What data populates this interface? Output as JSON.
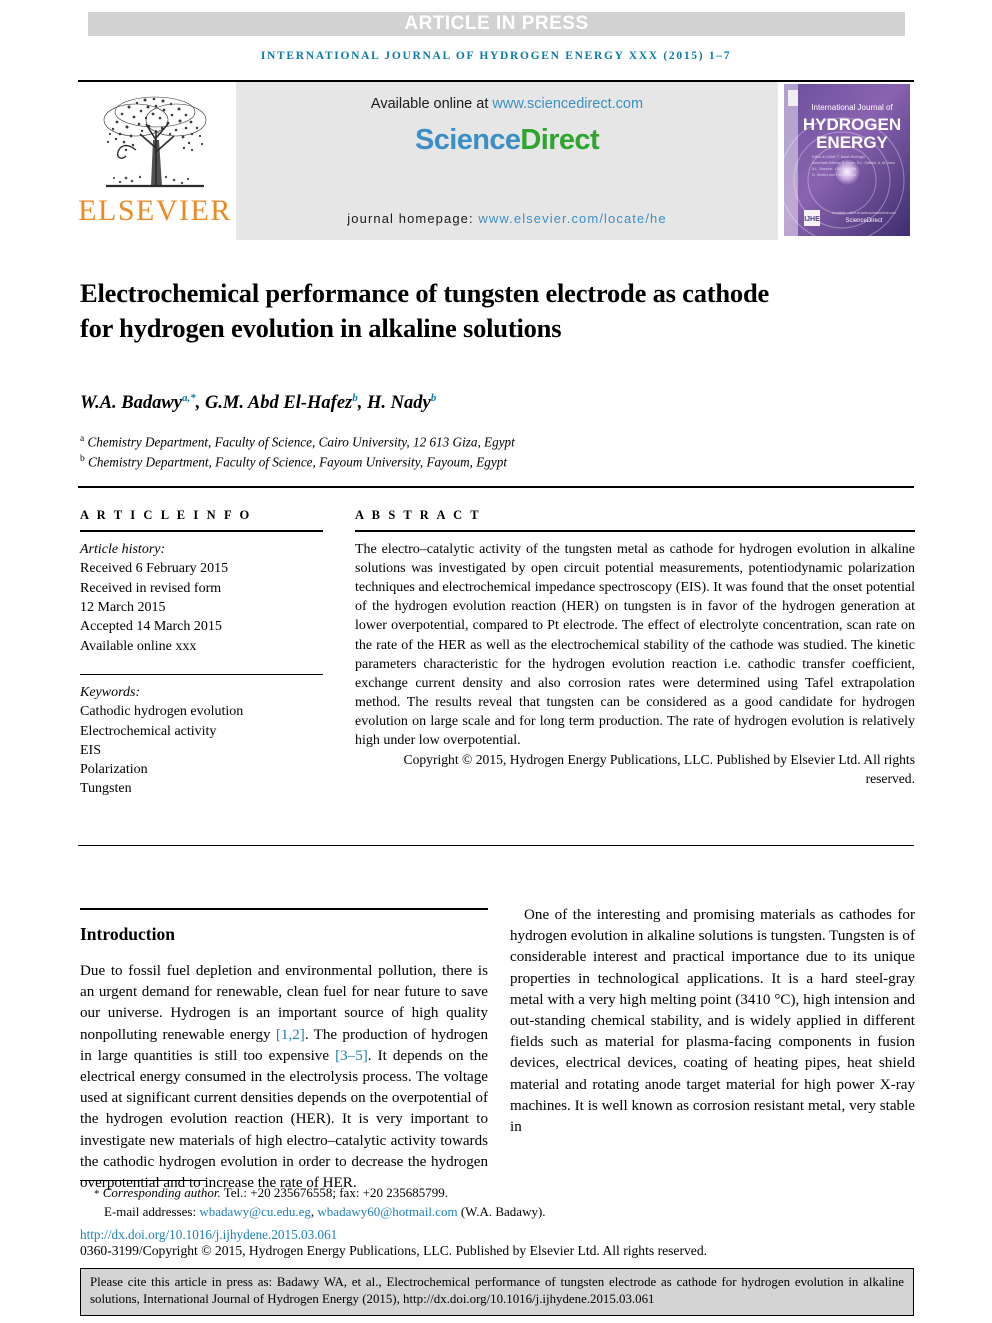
{
  "banner": {
    "text": "ARTICLE IN PRESS"
  },
  "running_head": "INTERNATIONAL JOURNAL OF HYDROGEN ENERGY XXX (2015) 1–7",
  "masthead": {
    "publisher_name": "ELSEVIER",
    "available_prefix": "Available online at ",
    "available_url": "www.sciencedirect.com",
    "logo_part1": "Science",
    "logo_part2": "Direct",
    "homepage_prefix": "journal homepage: ",
    "homepage_url": "www.elsevier.com/locate/he",
    "cover": {
      "line1": "International Journal of",
      "line2": "HYDROGEN",
      "line3": "ENERGY",
      "badge": "IJHE",
      "footer": "ScienceDirect"
    }
  },
  "article": {
    "title": "Electrochemical performance of tungsten electrode as cathode for hydrogen evolution in alkaline solutions",
    "authors": [
      {
        "name": "W.A. Badawy",
        "marks": "a,*"
      },
      {
        "name": "G.M. Abd El-Hafez",
        "marks": "b"
      },
      {
        "name": "H. Nady",
        "marks": "b"
      }
    ],
    "affiliations": [
      {
        "mark": "a",
        "text": "Chemistry Department, Faculty of Science, Cairo University, 12 613 Giza, Egypt"
      },
      {
        "mark": "b",
        "text": "Chemistry Department, Faculty of Science, Fayoum University, Fayoum, Egypt"
      }
    ]
  },
  "article_info": {
    "heading": "A R T I C L E    I N F O",
    "history_label": "Article history:",
    "history": [
      "Received 6 February 2015",
      "Received in revised form",
      "12 March 2015",
      "Accepted 14 March 2015",
      "Available online xxx"
    ],
    "keywords_label": "Keywords:",
    "keywords": [
      "Cathodic hydrogen evolution",
      "Electrochemical activity",
      "EIS",
      "Polarization",
      "Tungsten"
    ]
  },
  "abstract": {
    "heading": "A B S T R A C T",
    "text": "The electro–catalytic activity of the tungsten metal as cathode for hydrogen evolution in alkaline solutions was investigated by open circuit potential measurements, potentiodynamic polarization techniques and electrochemical impedance spectroscopy (EIS). It was found that the onset potential of the hydrogen evolution reaction (HER) on tungsten is in favor of the hydrogen generation at lower overpotential, compared to Pt electrode. The effect of electrolyte concentration, scan rate on the rate of the HER as well as the electrochemical stability of the cathode was studied. The kinetic parameters characteristic for the hydrogen evolution reaction i.e. cathodic transfer coefficient, exchange current density and also corrosion rates were determined using Tafel extrapolation method. The results reveal that tungsten can be considered as a good candidate for hydrogen evolution on large scale and for long term production. The rate of hydrogen evolution is relatively high under low overpotential.",
    "copyright": "Copyright © 2015, Hydrogen Energy Publications, LLC. Published by Elsevier Ltd. All rights reserved."
  },
  "introduction": {
    "heading": "Introduction",
    "para1_a": "Due to fossil fuel depletion and environmental pollution, there is an urgent demand for renewable, clean fuel for near future to save our universe. Hydrogen is an important source of high quality nonpolluting renewable energy ",
    "ref1": "[1,2]",
    "para1_b": ". The production of hydrogen in large quantities is still too expensive ",
    "ref2": "[3–5]",
    "para1_c": ". It depends on the electrical energy consumed in the electrolysis process. The voltage used at significant current densities depends on the overpotential of the hydrogen evolution reaction (HER). It is very important to investigate new materials of high electro–catalytic activity towards the cathodic hydrogen evolution in order to decrease the hydrogen overpotential and to increase the rate of HER.",
    "para2": "One of the interesting and promising materials as cathodes for hydrogen evolution in alkaline solutions is tungsten. Tungsten is of considerable interest and practical importance due to its unique properties in technological applications. It is a hard steel-gray metal with a very high melting point (3410 °C), high intension and out-standing chemical stability, and is widely applied in different fields such as material for plasma-facing components in fusion devices, electrical devices, coating of heating pipes, heat shield material and rotating anode target material for high power X-ray machines. It is well known as corrosion resistant metal, very stable in"
  },
  "footnote": {
    "star": "*",
    "corresponding_label": "Corresponding author.",
    "contact": " Tel.: +20 235676558; fax: +20 235685799.",
    "email_label": "E-mail addresses:",
    "email1": "wbadawy@cu.edu.eg",
    "email_sep": ", ",
    "email2": "wbadawy60@hotmail.com",
    "email_owner": " (W.A. Badawy).",
    "doi": "http://dx.doi.org/10.1016/j.ijhydene.2015.03.061",
    "issn": "0360-3199/Copyright © 2015, Hydrogen Energy Publications, LLC. Published by Elsevier Ltd. All rights reserved."
  },
  "cite_box": {
    "text": "Please cite this article in press as: Badawy WA, et al., Electrochemical performance of tungsten electrode as cathode for hydrogen evolution in alkaline solutions, International Journal of Hydrogen Energy (2015), http://dx.doi.org/10.1016/j.ijhydene.2015.03.061"
  },
  "colors": {
    "accent_blue": "#0b7ba8",
    "link_blue": "#1f7fb5",
    "elsevier_orange": "#eb8923",
    "sciencedirect_green": "#2ea52e",
    "sciencedirect_blue": "#3b8fc6",
    "banner_gray": "#d2d2d2",
    "cite_box_gray": "#d4d4d4"
  }
}
